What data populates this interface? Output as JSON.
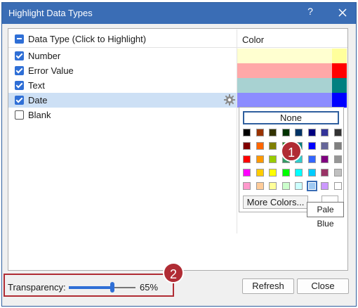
{
  "dialog": {
    "title": "Highlight Data Types",
    "help_label": "?",
    "colors": {
      "titlebar": "#3a6db5",
      "accent": "#2f6fd6",
      "badge": "#b02c34"
    }
  },
  "list": {
    "header": {
      "select_all_label": "Data Type (Click to Highlight)",
      "color_label": "Color"
    },
    "rows": [
      {
        "label": "Number",
        "checked": true,
        "color": "#ffffd0",
        "accent": "#ffff9c"
      },
      {
        "label": "Error Value",
        "checked": true,
        "color": "#ffa8a8",
        "accent": "#ff0000"
      },
      {
        "label": "Text",
        "checked": true,
        "color": "#a8d2d2",
        "accent": "#008080"
      },
      {
        "label": "Date",
        "checked": true,
        "color": "#8c8cff",
        "accent": "#0000ff",
        "selected": true
      },
      {
        "label": "Blank",
        "checked": false
      }
    ]
  },
  "picker": {
    "none_label": "None",
    "more_colors_label": "More Colors...",
    "tooltip": "Pale Blue",
    "selected": "Pale Blue",
    "palette": [
      [
        "#000000",
        "#993300",
        "#333300",
        "#003300",
        "#003366",
        "#000080",
        "#333399",
        "#333333"
      ],
      [
        "#800000",
        "#ff6600",
        "#808000",
        "#008000",
        "#008080",
        "#0000ff",
        "#666699",
        "#808080"
      ],
      [
        "#ff0000",
        "#ff9900",
        "#99cc00",
        "#339966",
        "#33cccc",
        "#3366ff",
        "#800080",
        "#969696"
      ],
      [
        "#ff00ff",
        "#ffcc00",
        "#ffff00",
        "#00ff00",
        "#00ffff",
        "#00ccff",
        "#993366",
        "#c0c0c0"
      ],
      [
        "#ff99cc",
        "#ffcc99",
        "#ffff99",
        "#ccffcc",
        "#ccffff",
        "#99ccff",
        "#cc99ff",
        "#ffffff"
      ]
    ]
  },
  "badges": {
    "one": "1",
    "two": "2"
  },
  "transparency": {
    "label": "Transparency:",
    "value": "65%",
    "level": 0.65
  },
  "buttons": {
    "refresh": "Refresh",
    "close": "Close"
  }
}
